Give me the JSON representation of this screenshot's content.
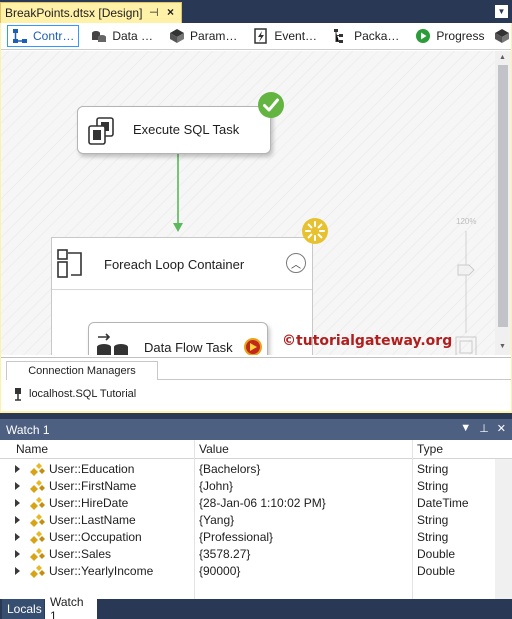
{
  "document_tab": {
    "title": "BreakPoints.dtsx [Design]",
    "pin": "⊣",
    "close": "×"
  },
  "designer_tabs": [
    {
      "label": "Contr…",
      "icon": "control-flow-icon"
    },
    {
      "label": "Data …",
      "icon": "data-flow-icon"
    },
    {
      "label": "Param…",
      "icon": "parameters-icon"
    },
    {
      "label": "Event…",
      "icon": "event-handlers-icon"
    },
    {
      "label": "Packa…",
      "icon": "package-explorer-icon"
    },
    {
      "label": "Progress",
      "icon": "progress-icon"
    }
  ],
  "canvas": {
    "execute_sql_task": {
      "label": "Execute SQL Task",
      "status": "success"
    },
    "foreach_container": {
      "label": "Foreach Loop Container",
      "status": "executing"
    },
    "data_flow_task": {
      "label": "Data Flow Task"
    },
    "zoom_label": "120%",
    "watermark": "©tutorialgateway.org"
  },
  "connection_managers": {
    "tab_label": "Connection Managers",
    "items": [
      {
        "label": "localhost.SQL Tutorial"
      }
    ]
  },
  "watch": {
    "title": "Watch 1",
    "columns": {
      "name": "Name",
      "value": "Value",
      "type": "Type"
    },
    "rows": [
      {
        "name": "User::Education",
        "value": "{Bachelors}",
        "type": "String"
      },
      {
        "name": "User::FirstName",
        "value": "{John}",
        "type": "String"
      },
      {
        "name": "User::HireDate",
        "value": "{28-Jan-06 1:10:02 PM}",
        "type": "DateTime"
      },
      {
        "name": "User::LastName",
        "value": "{Yang}",
        "type": "String"
      },
      {
        "name": "User::Occupation",
        "value": "{Professional}",
        "type": "String"
      },
      {
        "name": "User::Sales",
        "value": "{3578.27}",
        "type": "Double"
      },
      {
        "name": "User::YearlyIncome",
        "value": "{90000}",
        "type": "Double"
      }
    ]
  },
  "bottom_tabs": [
    {
      "label": "Locals"
    },
    {
      "label": "Watch 1"
    }
  ],
  "colors": {
    "accent_yellow": "#fff1a8",
    "chrome_dark": "#293955",
    "panel_title": "#4d6082",
    "success_green": "#5cb85c",
    "executing_gold": "#e7c230"
  }
}
